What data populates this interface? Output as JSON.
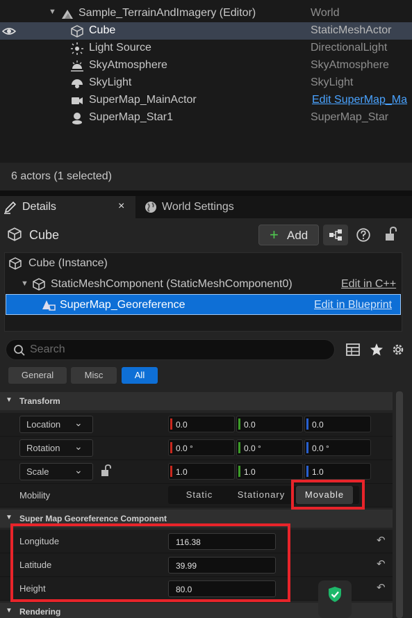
{
  "outliner": {
    "rows": [
      {
        "label": "Sample_TerrainAndImagery (Editor)",
        "type": "World",
        "icon": "level-icon"
      },
      {
        "label": "Cube",
        "type": "StaticMeshActor",
        "icon": "cube-icon"
      },
      {
        "label": "Light Source",
        "type": "DirectionalLight",
        "icon": "sun-icon"
      },
      {
        "label": "SkyAtmosphere",
        "type": "SkyAtmosphere",
        "icon": "sky-atmosphere-icon"
      },
      {
        "label": "SkyLight",
        "type": "SkyLight",
        "icon": "skylight-icon"
      },
      {
        "label": "SuperMap_MainActor",
        "type": "Edit SuperMap_Ma",
        "icon": "camera-icon"
      },
      {
        "label": "SuperMap_Star1",
        "type": "SuperMap_Star",
        "icon": "pawn-icon"
      }
    ],
    "status": "6 actors (1 selected)"
  },
  "tabs": {
    "details": "Details",
    "close": "×",
    "world_settings": "World Settings"
  },
  "details": {
    "actor_name": "Cube",
    "add_label": "Add",
    "add_plus": "+",
    "components": {
      "instance": "Cube (Instance)",
      "static_mesh": "StaticMeshComponent (StaticMeshComponent0)",
      "static_mesh_link": "Edit in C++",
      "georef": "SuperMap_Georeference",
      "georef_link": "Edit in Blueprint"
    },
    "search_placeholder": "Search",
    "filters": [
      "General",
      "Misc",
      "All"
    ],
    "transform": {
      "title": "Transform",
      "location_label": "Location",
      "location": [
        "0.0",
        "0.0",
        "0.0"
      ],
      "rotation_label": "Rotation",
      "rotation": [
        "0.0 °",
        "0.0 °",
        "0.0 °"
      ],
      "scale_label": "Scale",
      "scale": [
        "1.0",
        "1.0",
        "1.0"
      ],
      "mobility_label": "Mobility",
      "mobility_options": [
        "Static",
        "Stationary",
        "Movable"
      ],
      "mobility_selected": "Movable"
    },
    "georef_section": {
      "title": "Super Map Georeference Component",
      "longitude_label": "Longitude",
      "longitude": "116.38",
      "latitude_label": "Latitude",
      "latitude": "39.99",
      "height_label": "Height",
      "height": "80.0"
    },
    "rendering_title": "Rendering"
  },
  "colors": {
    "accent": "#0e6fd6",
    "highlight": "#e8242a",
    "x_axis": "#c8281e",
    "y_axis": "#3c9c28",
    "z_axis": "#2860d0"
  }
}
